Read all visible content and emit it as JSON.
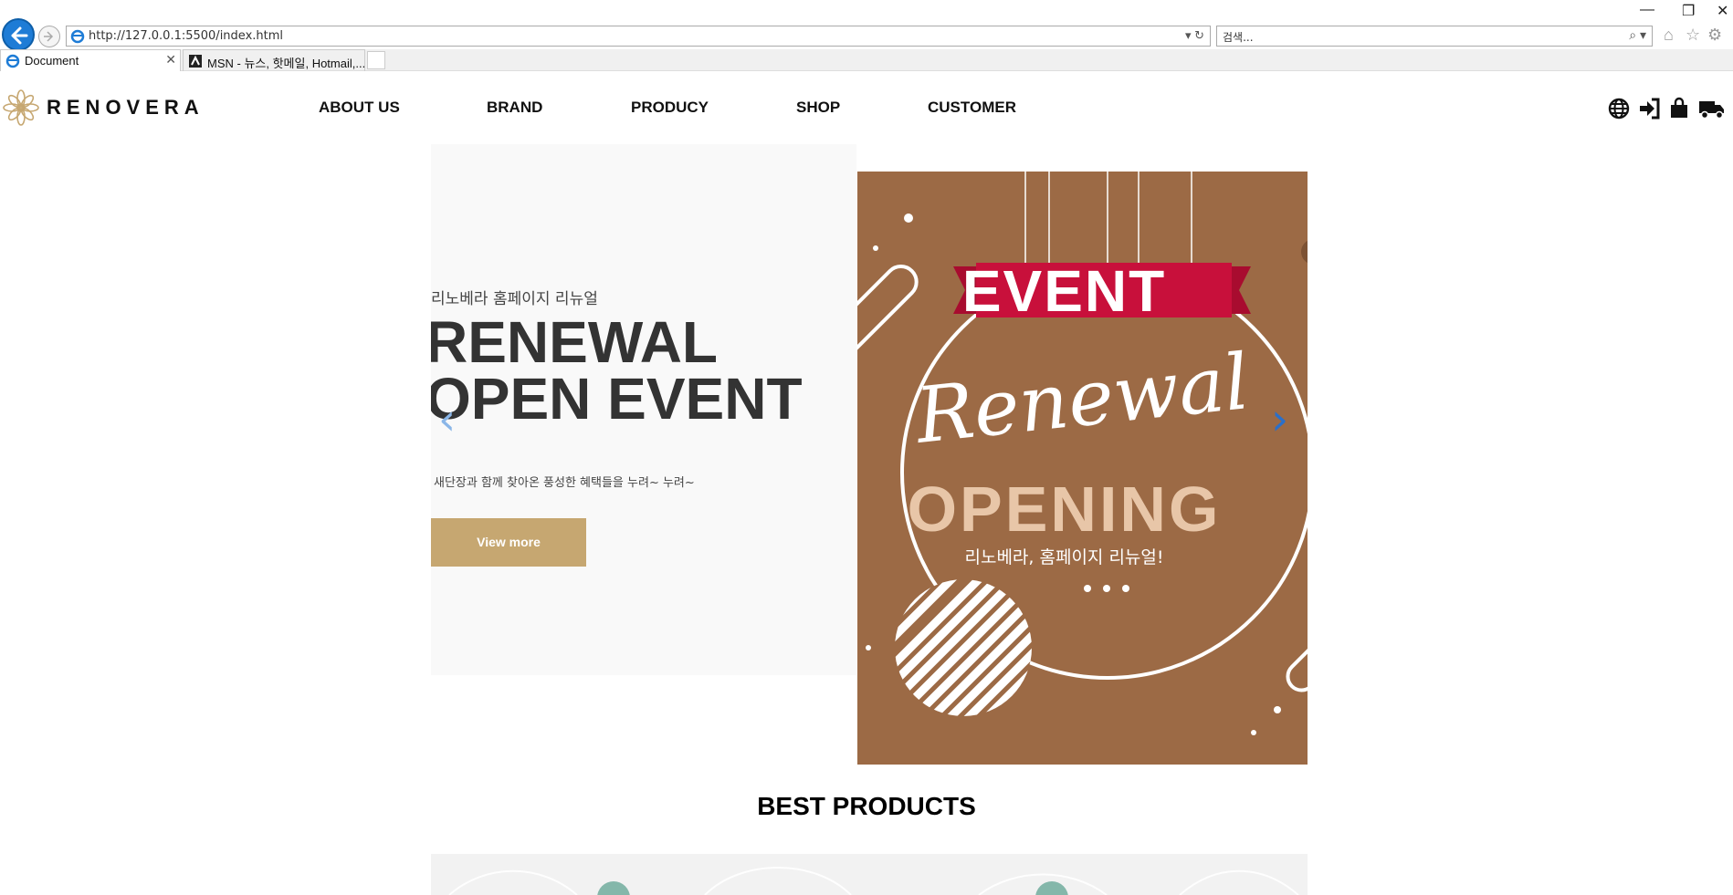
{
  "browser": {
    "url": "http://127.0.0.1:5500/index.html",
    "search_placeholder": "검색...",
    "tabs": [
      {
        "label": "Document",
        "active": true
      },
      {
        "label": "MSN - 뉴스, 핫메일, Hotmail,...",
        "active": false
      }
    ]
  },
  "site": {
    "logo": "RENOVERA",
    "nav": [
      "ABOUT US",
      "BRAND",
      "PRODUCY",
      "SHOP",
      "CUSTOMER"
    ],
    "header_icons": [
      "globe-icon",
      "sign-in-icon",
      "shopping-bag-icon",
      "truck-icon"
    ],
    "accent_color": "#c6a771"
  },
  "hero": {
    "subtitle": "리노베라 홈페이지 리뉴얼",
    "headline_line1": "RENEWAL",
    "headline_line2": "OPEN EVENT",
    "description": "새단장과 함께 찾아온 풍성한 혜택들을 누려~ 누려~",
    "button": "View more",
    "poster": {
      "ribbon": "EVENT",
      "script": "Renewal",
      "big": "OPENING",
      "caption": "리노베라, 홈페이지 리뉴얼!",
      "bg_color": "#9c6a45",
      "ribbon_color": "#c8103b"
    }
  },
  "section": {
    "best_title": "BEST PRODUCTS"
  }
}
